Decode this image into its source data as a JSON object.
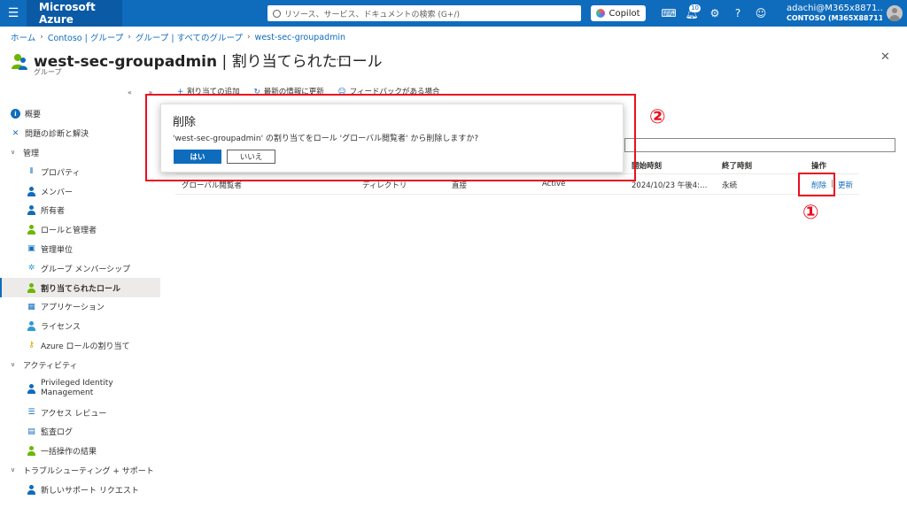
{
  "topbar": {
    "brand": "Microsoft Azure",
    "search_placeholder": "リソース、サービス、ドキュメントの検索 (G+/)",
    "copilot_label": "Copilot",
    "notifications_count": "10",
    "account_name": "adachi@M365x8871…",
    "account_tenant": "CONTOSO (M365X8871133…"
  },
  "breadcrumb": {
    "home": "ホーム",
    "contoso": "Contoso | グループ",
    "all_groups": "グループ | すべてのグループ",
    "current": "west-sec-groupadmin"
  },
  "header": {
    "title_main": "west-sec-groupadmin",
    "title_sep": " | ",
    "title_sub": "割り当てられたロール",
    "subtitle": "グループ",
    "more": "…"
  },
  "sidebar": {
    "items": [
      {
        "label": "概要"
      },
      {
        "label": "問題の診断と解決"
      },
      {
        "label": "管理"
      },
      {
        "label": "プロパティ"
      },
      {
        "label": "メンバー"
      },
      {
        "label": "所有者"
      },
      {
        "label": "ロールと管理者"
      },
      {
        "label": "管理単位"
      },
      {
        "label": "グループ メンバーシップ"
      },
      {
        "label": "割り当てられたロール"
      },
      {
        "label": "アプリケーション"
      },
      {
        "label": "ライセンス"
      },
      {
        "label": "Azure ロールの割り当て"
      },
      {
        "label": "アクティビティ"
      },
      {
        "label": "Privileged Identity Management"
      },
      {
        "label": "アクセス レビュー"
      },
      {
        "label": "監査ログ"
      },
      {
        "label": "一括操作の結果"
      },
      {
        "label": "トラブルシューティング + サポート"
      },
      {
        "label": "新しいサポート リクエスト"
      }
    ]
  },
  "toolbar": {
    "add": "割り当ての追加",
    "refresh": "最新の情報に更新",
    "feedback": "フィードバックがある場合"
  },
  "table": {
    "headers": {
      "start": "開始時刻",
      "end": "終了時刻",
      "actions": "操作"
    },
    "row": {
      "role": "グローバル閲覧者",
      "scope": "ディレクトリ",
      "type": "直接",
      "state": "Active",
      "start": "2024/10/23 午後4:…",
      "end": "永続",
      "remove": "削除",
      "update": "更新"
    }
  },
  "dialog": {
    "title": "削除",
    "message": "'west-sec-groupadmin' の割り当てをロール 'グローバル閲覧者' から削除しますか?",
    "yes": "はい",
    "no": "いいえ"
  },
  "annotations": {
    "one": "①",
    "two": "②",
    "color": "#e8101e"
  },
  "colors": {
    "accent": "#0f6cbd",
    "topbar": "#0f6cbd"
  }
}
